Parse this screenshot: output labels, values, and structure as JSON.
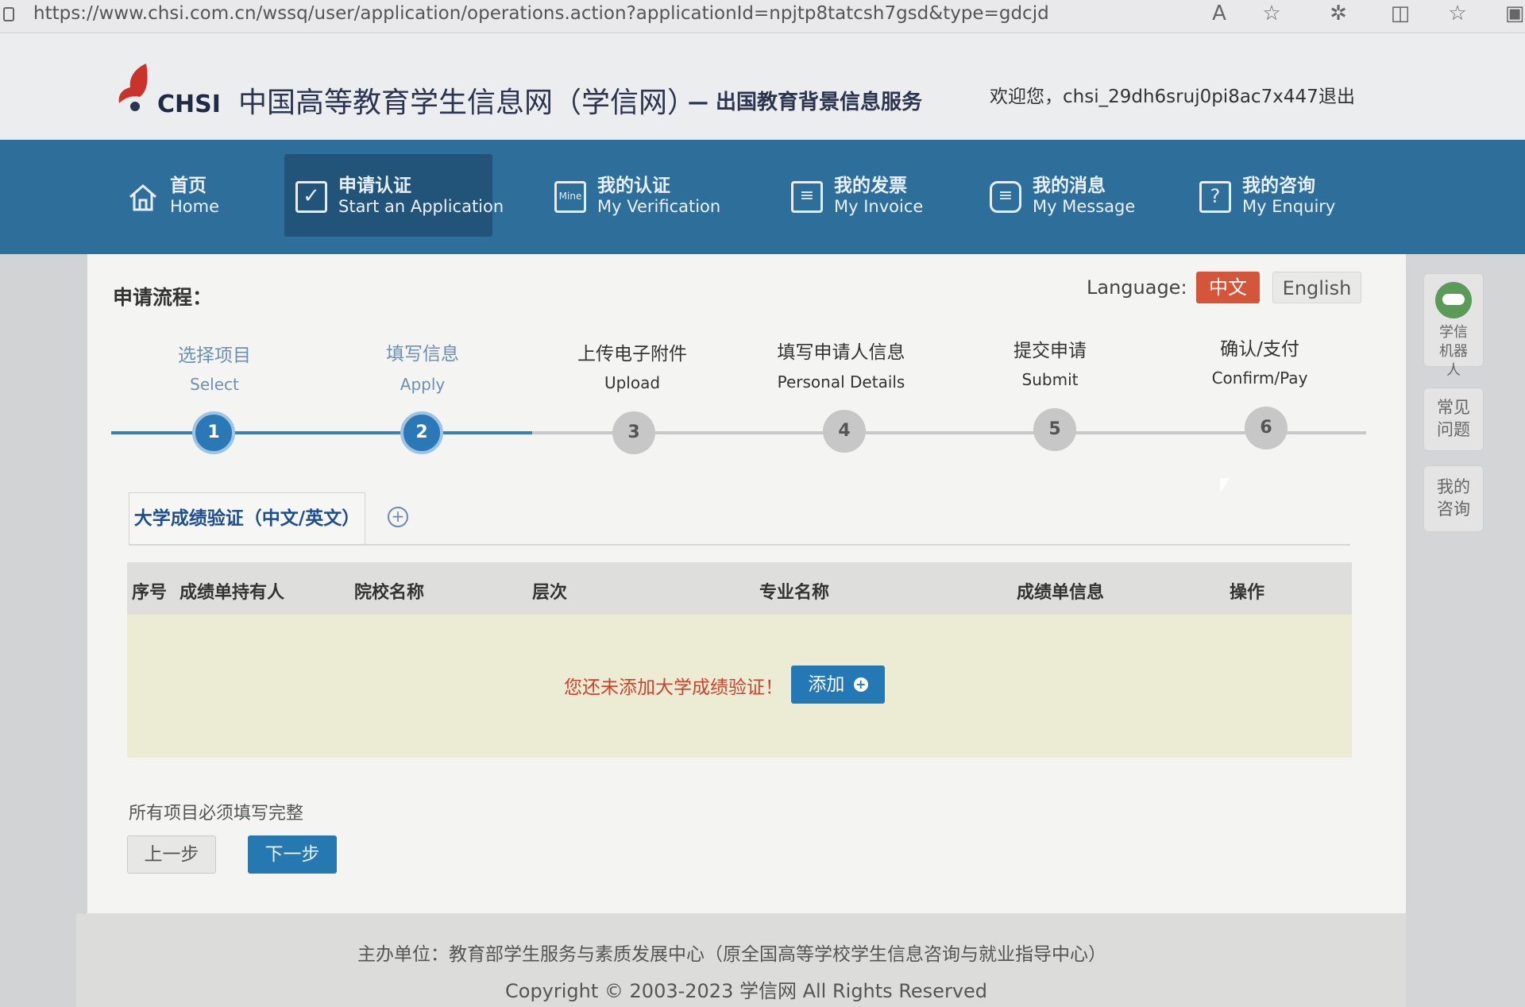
{
  "browser": {
    "url": "https://www.chsi.com.cn/wssq/user/application/operations.action?applicationId=npjtp8tatcsh7gsd&type=gdcjd",
    "icons": [
      "read-aloud-icon",
      "favorite-star-icon",
      "extensions-icon",
      "split-screen-icon",
      "favorites-icon",
      "collections-icon"
    ]
  },
  "header": {
    "logo_text": "CHSI",
    "site_title": "中国高等教育学生信息网（学信网）",
    "site_subtitle": "— 出国教育背景信息服务",
    "welcome": "欢迎您，chsi_29dh6sruj0pi8ac7x447",
    "logout": "退出"
  },
  "nav": [
    {
      "cn": "首页",
      "en": "Home",
      "icon": "home-icon"
    },
    {
      "cn": "申请认证",
      "en": "Start an Application",
      "icon": "check-box-icon"
    },
    {
      "cn": "我的认证",
      "en": "My Verification",
      "icon": "certificate-icon"
    },
    {
      "cn": "我的发票",
      "en": "My Invoice",
      "icon": "invoice-icon"
    },
    {
      "cn": "我的消息",
      "en": "My Message",
      "icon": "message-icon"
    },
    {
      "cn": "我的咨询",
      "en": "My Enquiry",
      "icon": "question-icon"
    }
  ],
  "process": {
    "title": "申请流程：",
    "language_label": "Language:",
    "lang_cn": "中文",
    "lang_en": "English",
    "steps": [
      {
        "cn": "选择项目",
        "en": "Select",
        "num": "1"
      },
      {
        "cn": "填写信息",
        "en": "Apply",
        "num": "2"
      },
      {
        "cn": "上传电子附件",
        "en": "Upload",
        "num": "3"
      },
      {
        "cn": "填写申请人信息",
        "en": "Personal Details",
        "num": "4"
      },
      {
        "cn": "提交申请",
        "en": "Submit",
        "num": "5"
      },
      {
        "cn": "确认/支付",
        "en": "Confirm/Pay",
        "num": "6"
      }
    ],
    "completed_steps": 2
  },
  "tabs": {
    "active": "大学成绩验证（中文/英文）",
    "add_symbol": "+"
  },
  "table": {
    "headers": [
      "序号",
      "成绩单持有人",
      "院校名称",
      "层次",
      "专业名称",
      "成绩单信息",
      "操作"
    ],
    "empty_message": "您还未添加大学成绩验证！",
    "add_button": "添加"
  },
  "form": {
    "required_note": "所有项目必须填写完整",
    "prev": "上一步",
    "next": "下一步"
  },
  "sidebar": {
    "robot": "学信机器人",
    "faq": "常见问题",
    "my_enquiry": "我的咨询"
  },
  "footer": {
    "org": "主办单位：教育部学生服务与素质发展中心（原全国高等学校学生信息咨询与就业指导中心）",
    "copyright": "Copyright © 2003-2023 学信网 All Rights Reserved"
  },
  "colors": {
    "nav_bg": "#2e6e9b",
    "accent_blue": "#2478b4",
    "lang_active": "#d4553a",
    "empty_msg": "#c8442e"
  }
}
